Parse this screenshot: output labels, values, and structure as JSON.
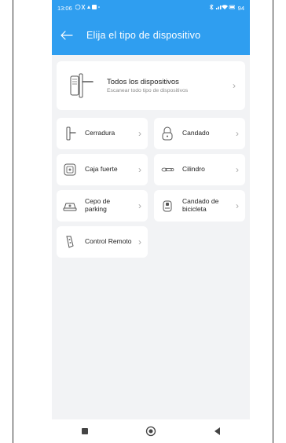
{
  "status": {
    "time": "13:06",
    "battery": "94",
    "accent": "#2f9ef0"
  },
  "header": {
    "title": "Elija el tipo de dispositivo",
    "back_icon": "arrow-left-icon"
  },
  "all_devices": {
    "title": "Todos los dispositivos",
    "subtitle": "Escanear todo tipo de dispositivos"
  },
  "devices": [
    {
      "label": "Cerradura"
    },
    {
      "label": "Candado"
    },
    {
      "label": "Caja fuerte"
    },
    {
      "label": "Cilindro"
    },
    {
      "label": "Cepo de parking"
    },
    {
      "label": "Candado de bicicleta"
    },
    {
      "label": "Control Remoto"
    }
  ]
}
